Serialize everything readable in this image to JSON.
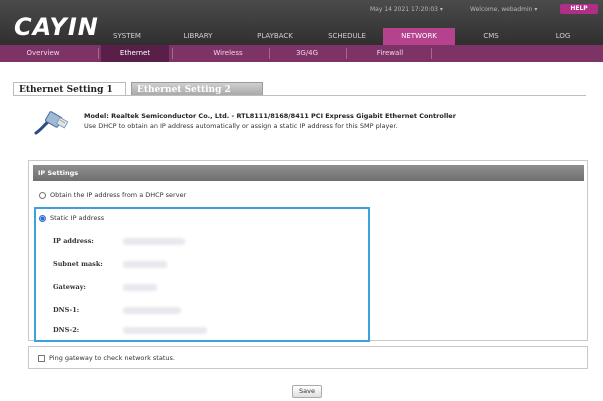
{
  "brand": {
    "logo": "CAYIN"
  },
  "status": {
    "datetime": "May 14 2021 17:20:03",
    "welcome": "Welcome, webadmin",
    "help_label": "HELP"
  },
  "main_tabs": [
    {
      "label": "SYSTEM",
      "active": false
    },
    {
      "label": "LIBRARY",
      "active": false
    },
    {
      "label": "PLAYBACK",
      "active": false
    },
    {
      "label": "SCHEDULE",
      "active": false
    },
    {
      "label": "NETWORK",
      "active": true
    },
    {
      "label": "CMS",
      "active": false
    },
    {
      "label": "LOG",
      "active": false
    }
  ],
  "subnav": [
    {
      "label": "Overview",
      "active": false
    },
    {
      "label": "Ethernet",
      "active": true
    },
    {
      "label": "Wireless",
      "active": false
    },
    {
      "label": "3G/4G",
      "active": false
    },
    {
      "label": "Firewall",
      "active": false
    }
  ],
  "section_tabs": {
    "active": "Ethernet Setting 1",
    "inactive": "Ethernet Setting 2"
  },
  "model": {
    "title": "Model: Realtek Semiconductor Co., Ltd. - RTL8111/8168/8411 PCI Express Gigabit Ethernet Controller",
    "description": "Use DHCP to obtain an IP address automatically or assign a static IP address for this SMP player."
  },
  "ip_settings": {
    "header": "IP Settings",
    "dhcp_option": "Obtain the IP address from a DHCP server",
    "static_option": "Static IP address",
    "selected": "static",
    "fields": [
      {
        "label": "IP address:"
      },
      {
        "label": "Subnet mask:"
      },
      {
        "label": "Gateway:"
      },
      {
        "label": "DNS-1:"
      },
      {
        "label": "DNS-2:"
      }
    ]
  },
  "ping": {
    "label": "Ping gateway to check network status.",
    "checked": false
  },
  "actions": {
    "save_label": "Save"
  },
  "colors": {
    "accent": "#b4428c",
    "subnav": "#7e3366",
    "focus_border": "#3aa3df"
  }
}
